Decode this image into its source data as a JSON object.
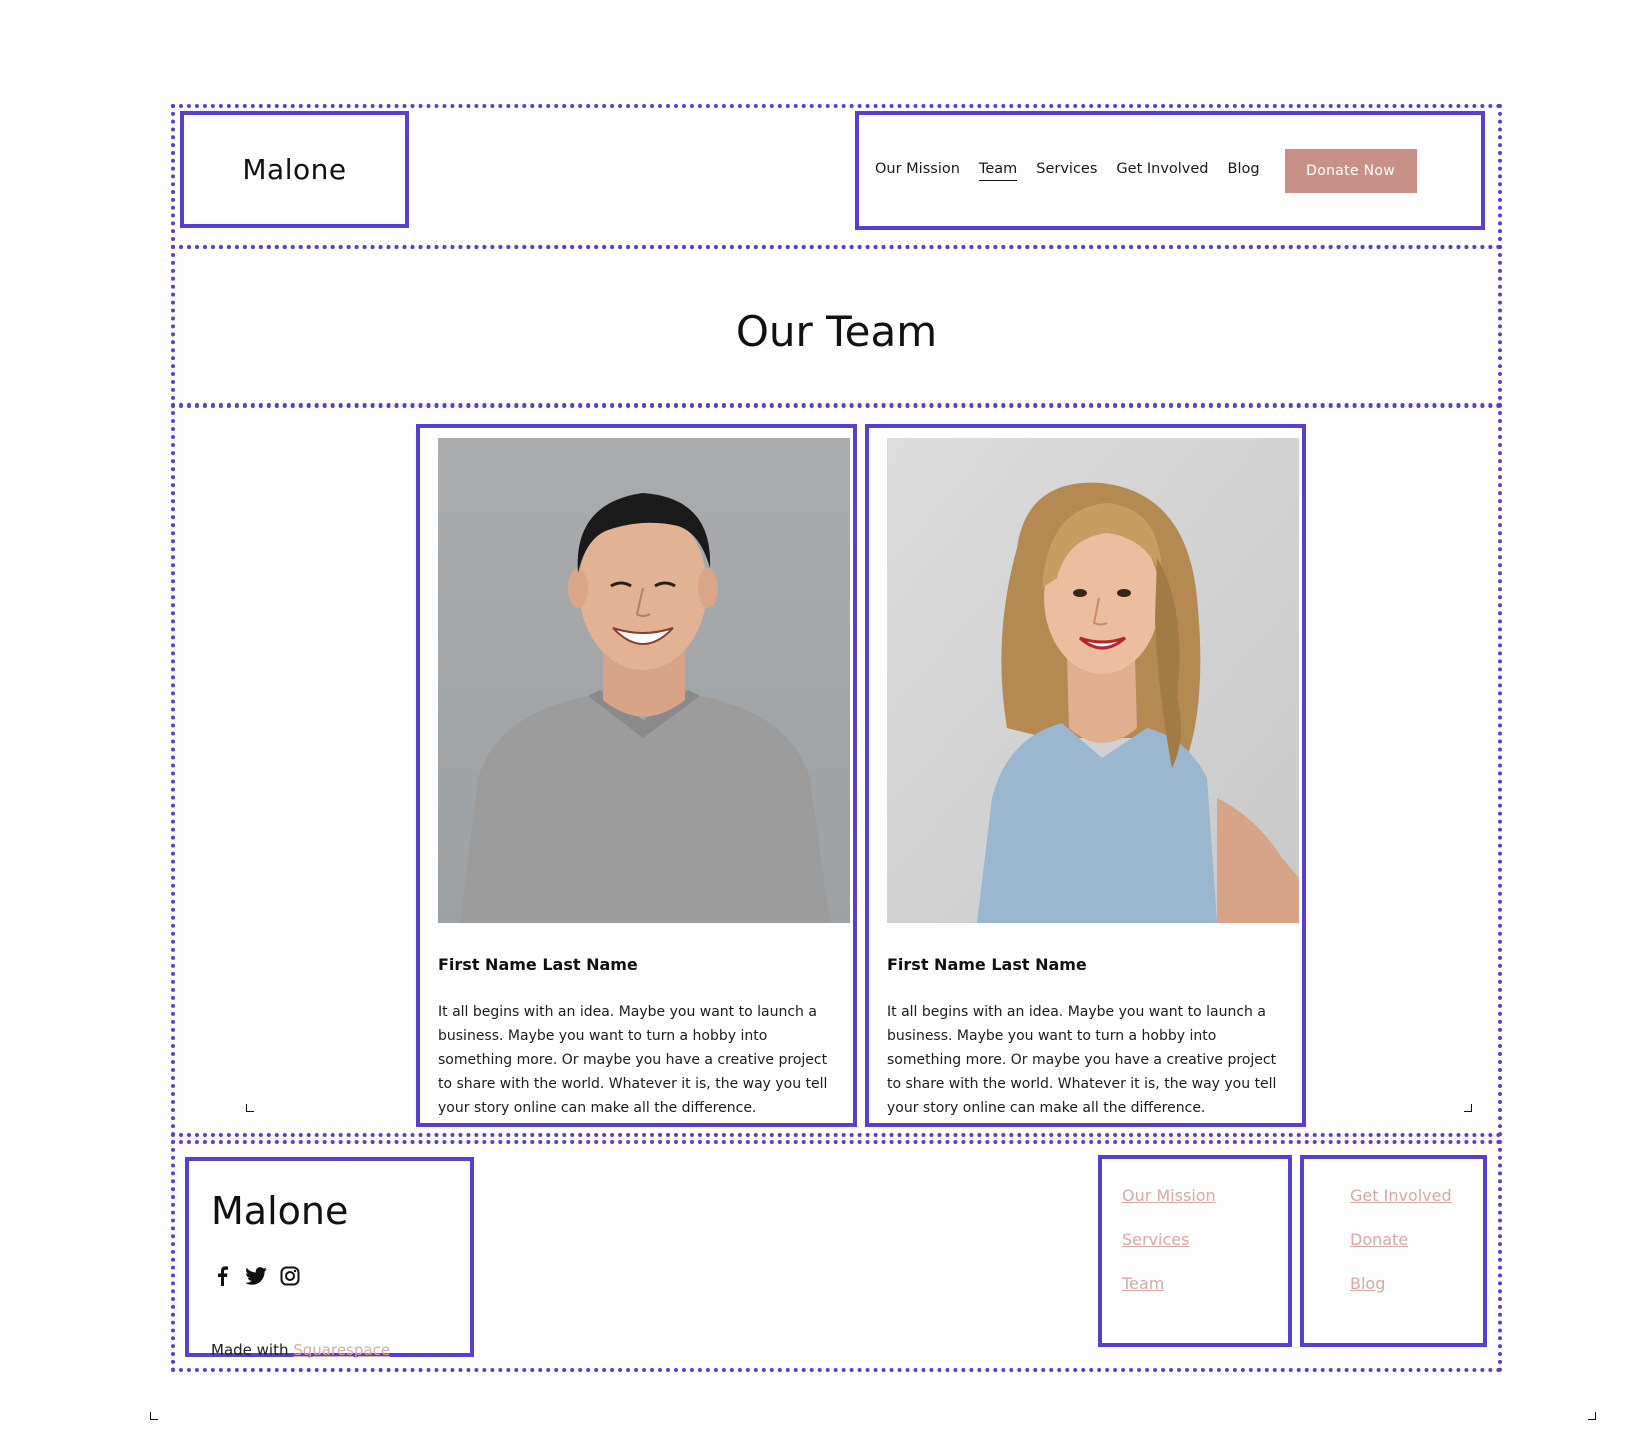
{
  "header": {
    "logo": "Malone",
    "nav": [
      {
        "label": "Our Mission",
        "active": false
      },
      {
        "label": "Team",
        "active": true
      },
      {
        "label": "Services",
        "active": false
      },
      {
        "label": "Get Involved",
        "active": false
      },
      {
        "label": "Blog",
        "active": false
      }
    ],
    "cta_label": "Donate Now"
  },
  "page_title": "Our Team",
  "team": [
    {
      "name": "First Name Last Name",
      "bio": "It all begins with an idea. Maybe you want to launch a business. Maybe you want to turn a hobby into something more. Or maybe you have a creative project to share with the world. Whatever it is, the way you tell your story online can make all the difference."
    },
    {
      "name": "First Name Last Name",
      "bio": "It all begins with an idea. Maybe you want to launch a business. Maybe you want to turn a hobby into something more. Or maybe you have a creative project to share with the world. Whatever it is, the way you tell your story online can make all the difference."
    }
  ],
  "footer": {
    "logo": "Malone",
    "social_icons": [
      "facebook-icon",
      "twitter-icon",
      "instagram-icon"
    ],
    "made_with_prefix": "Made with ",
    "made_with_link": "Squarespace",
    "links_col_1": [
      "Our Mission",
      "Services",
      "Team"
    ],
    "links_col_2": [
      "Get Involved",
      "Donate",
      "Blog"
    ]
  },
  "colors": {
    "accent": "#c89188",
    "link": "#d8a9a1",
    "outline": "#5a3fcf"
  }
}
